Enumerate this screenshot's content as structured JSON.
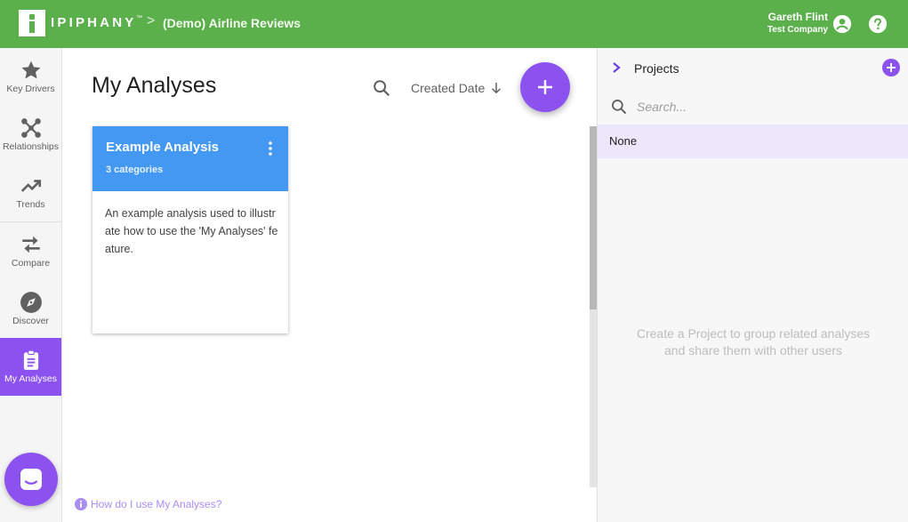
{
  "header": {
    "brand": "IPIPHANY",
    "brand_tm": "™",
    "breadcrumb_separator": ">",
    "breadcrumb": "(Demo) Airline Reviews",
    "user_name": "Gareth Flint",
    "user_company": "Test Company",
    "icons": [
      "logo",
      "account-circle-icon",
      "help-icon"
    ],
    "color": "#5bb04b"
  },
  "sidebar": {
    "items": [
      {
        "label": "Key Drivers",
        "icon": "star-icon"
      },
      {
        "label": "Relationships",
        "icon": "network-icon"
      },
      {
        "label": "Trends",
        "icon": "trending-up-icon"
      },
      {
        "label": "Compare",
        "icon": "swap-icon"
      },
      {
        "label": "Discover",
        "icon": "compass-icon"
      },
      {
        "label": "My Analyses",
        "icon": "clipboard-icon",
        "active": true
      }
    ],
    "active_color": "#8c52f0"
  },
  "main": {
    "title": "My Analyses",
    "sort_label": "Created Date",
    "cards": [
      {
        "title": "Example Analysis",
        "subtitle": "3 categories",
        "description": "An example analysis used to illustrate how to use the 'My Analyses' feature."
      }
    ],
    "help_link": "How do I use My Analyses?"
  },
  "projects": {
    "title": "Projects",
    "search_placeholder": "Search...",
    "none_label": "None",
    "empty_message_line1": "Create a Project to group related analyses",
    "empty_message_line2": "and share them with other users"
  },
  "colors": {
    "accent": "#8c52f0",
    "card_header": "#4399f1",
    "header_green": "#5bb04b"
  }
}
